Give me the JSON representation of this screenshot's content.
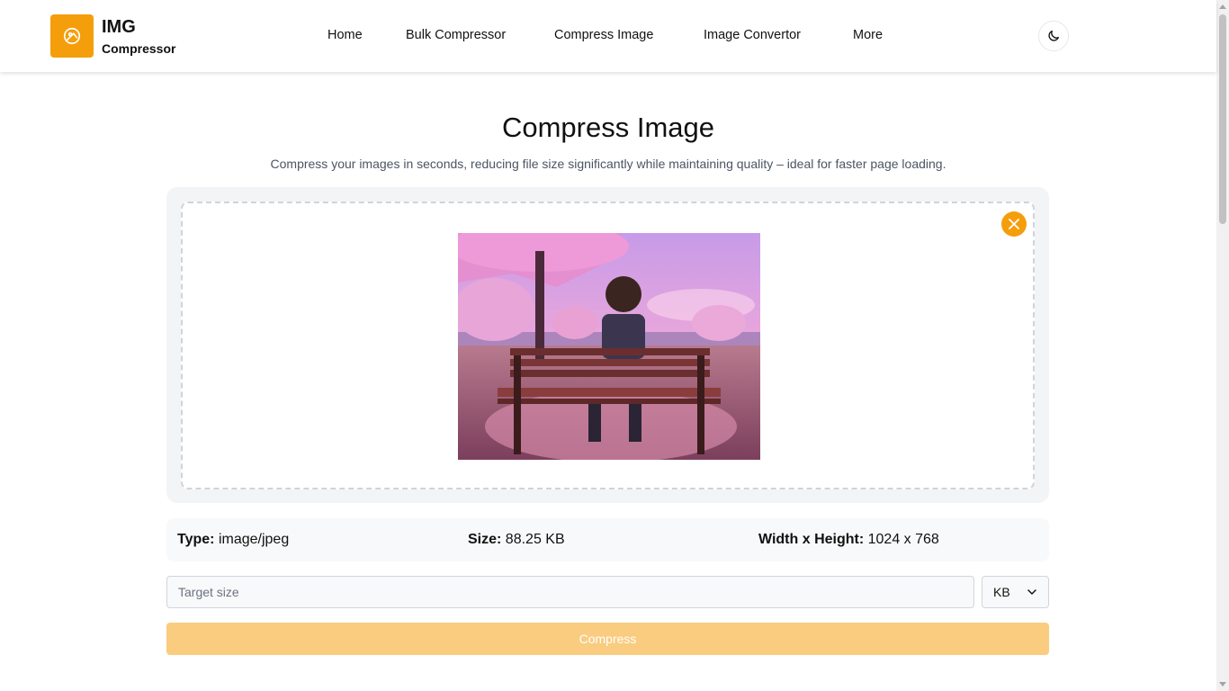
{
  "brand": {
    "title": "IMG",
    "subtitle": "Compressor",
    "logo_icon": "image-icon",
    "accent_color": "#f59e0b"
  },
  "nav": {
    "items": [
      {
        "label": "Home"
      },
      {
        "label": "Bulk Compressor"
      },
      {
        "label": "Compress Image"
      },
      {
        "label": "Image Convertor"
      },
      {
        "label": "More"
      }
    ],
    "theme_toggle_icon": "moon-icon"
  },
  "main": {
    "title": "Compress Image",
    "description": "Compress your images in seconds, reducing file size significantly while maintaining quality – ideal for faster page loading."
  },
  "upload": {
    "remove_icon": "close-icon",
    "preview_icon": "uploaded-image-preview"
  },
  "file_info": {
    "type_label": "Type:",
    "type_value": "image/jpeg",
    "size_label": "Size:",
    "size_value": "88.25 KB",
    "dims_label": "Width x Height:",
    "dims_value": "1024 x 768"
  },
  "controls": {
    "target_placeholder": "Target size",
    "target_value": "",
    "unit_selected": "KB",
    "compress_label": "Compress"
  }
}
